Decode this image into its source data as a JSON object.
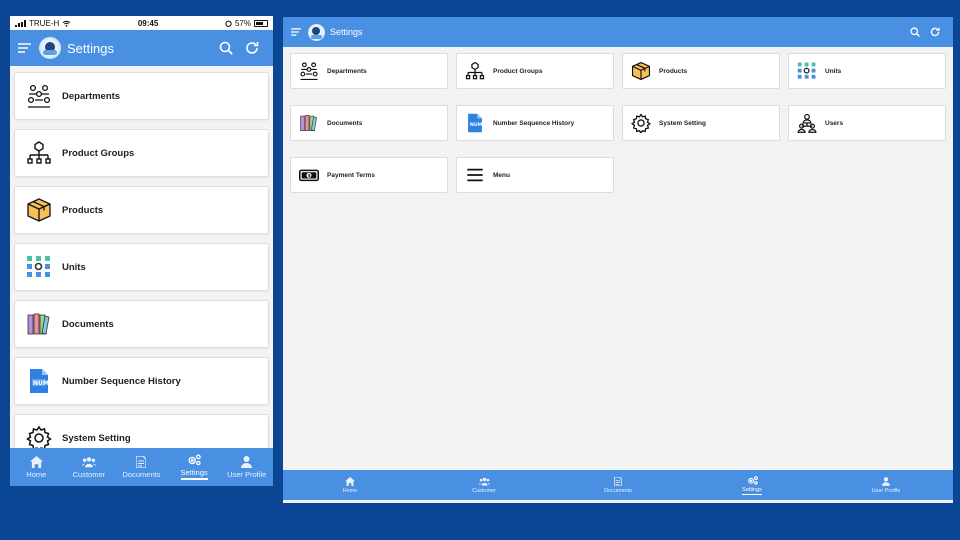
{
  "phone": {
    "status": {
      "carrier": "TRUE-H",
      "time": "09:45",
      "battery": "57%"
    },
    "title": "Settings",
    "items": [
      {
        "label": "Departments",
        "icon": "departments-icon"
      },
      {
        "label": "Product Groups",
        "icon": "hierarchy-icon"
      },
      {
        "label": "Products",
        "icon": "box-icon"
      },
      {
        "label": "Units",
        "icon": "units-icon"
      },
      {
        "label": "Documents",
        "icon": "binders-icon"
      },
      {
        "label": "Number Sequence History",
        "icon": "num-file-icon"
      },
      {
        "label": "System Setting",
        "icon": "gear-icon"
      }
    ]
  },
  "tablet": {
    "title": "Settings",
    "items": [
      {
        "label": "Departments",
        "icon": "departments-icon"
      },
      {
        "label": "Product Groups",
        "icon": "hierarchy-icon"
      },
      {
        "label": "Products",
        "icon": "box-icon"
      },
      {
        "label": "Units",
        "icon": "units-icon"
      },
      {
        "label": "Documents",
        "icon": "binders-icon"
      },
      {
        "label": "Number Sequence History",
        "icon": "num-file-icon"
      },
      {
        "label": "System Setting",
        "icon": "gear-icon"
      },
      {
        "label": "Users",
        "icon": "users-icon"
      },
      {
        "label": "Payment Terms",
        "icon": "money-icon"
      },
      {
        "label": "Menu",
        "icon": "menu-lines-icon"
      }
    ]
  },
  "bottom_nav": [
    {
      "label": "Home",
      "icon": "home-icon"
    },
    {
      "label": "Customer",
      "icon": "customer-icon"
    },
    {
      "label": "Documents",
      "icon": "document-icon"
    },
    {
      "label": "Settings",
      "icon": "settings-gears-icon",
      "active": true
    },
    {
      "label": "User Profile",
      "icon": "user-icon"
    }
  ],
  "colors": {
    "background": "#0b4694",
    "primary": "#4a90e2",
    "surface": "#f2f2f2",
    "card": "#ffffff"
  }
}
